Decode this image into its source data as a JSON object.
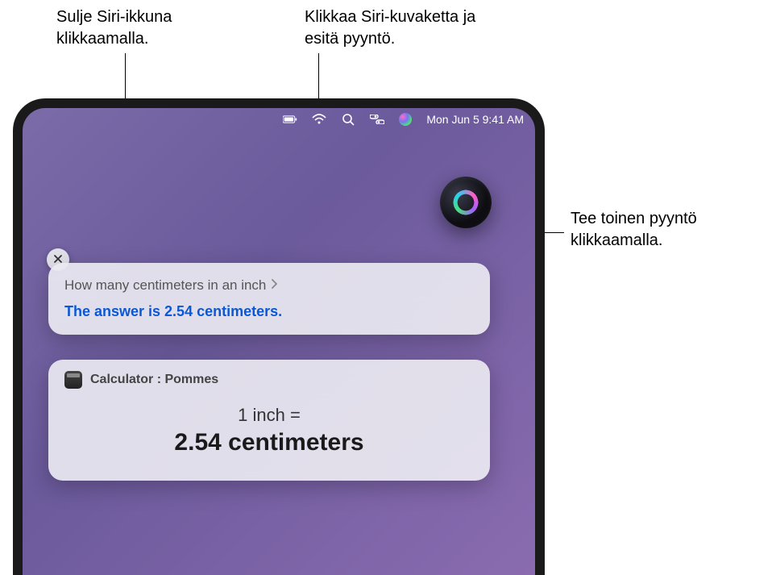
{
  "callouts": {
    "close": "Sulje Siri-ikkuna klikkaamalla.",
    "menubar_siri": "Klikkaa Siri-kuvaketta ja esitä pyyntö.",
    "orb": "Tee toinen pyyntö klikkaamalla."
  },
  "menubar": {
    "datetime": "Mon Jun 5  9:41 AM"
  },
  "siri": {
    "query": "How many centimeters in an inch",
    "answer": "The answer is 2.54 centimeters.",
    "calculator": {
      "title": "Calculator : Pommes",
      "input": "1 inch =",
      "output": "2.54 centimeters"
    }
  }
}
